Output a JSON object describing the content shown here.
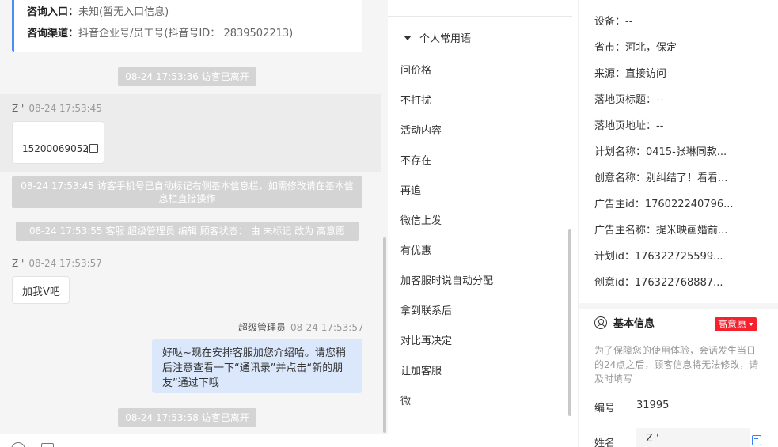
{
  "chat": {
    "info_card": {
      "entry_label": "咨询入口：",
      "entry_value": "未知(暂无入口信息)",
      "channel_label": "咨询渠道：",
      "channel_value": "抖音企业号/员工号(抖音号ID： 2839502213)"
    },
    "sys_left_1": "08-24 17:53:36 访客已离开",
    "visitor_name": "Z '",
    "msg1_time": "08-24 17:53:45",
    "msg1_text": "15200069052",
    "sys_phone_note": "08-24 17:53:45 访客手机号已自动标记右侧基本信息栏，如需修改请在基本信息栏直接操作",
    "sys_status_change": "08-24 17:53:55 客服 超级管理员 编辑 顾客状态： 由 未标记 改为 高意愿",
    "msg2_time": "08-24 17:53:57",
    "msg2_text": "加我V吧",
    "agent_name": "超级管理员",
    "msg3_time": "08-24 17:53:57",
    "msg3_text": "好哒~现在安排客服加您介绍哈。请您稍后注意查看一下“通讯录”并点击“新的朋友”通过下哦",
    "sys_left_2": "08-24 17:53:58 访客已离开"
  },
  "phrases": {
    "header": "个人常用语",
    "items": [
      "问价格",
      "不打扰",
      "活动内容",
      "不存在",
      "再追",
      "微信上发",
      "有优惠",
      "加客服时说自动分配",
      "拿到联系后",
      "对比再决定",
      "让加客服",
      "微"
    ]
  },
  "right": {
    "kv": [
      "设备：--",
      "省市：河北，保定",
      "来源：直接访问",
      "落地页标题：--",
      "落地页地址：--",
      "计划名称：0415-张琳同款...",
      "创意名称：别纠结了！看看...",
      "广告主id：176022240796...",
      "广告主名称：提米映画婚前...",
      "计划id：176322725599...",
      "创意id：176322768887..."
    ],
    "basic_info_title": "基本信息",
    "intent_badge": "高意愿",
    "notice": "为了保障您的使用体验，会话发生当日的24点之后，顾客信息将无法修改，请及时填写",
    "number_label": "编号",
    "number_value": "31995",
    "name_label": "姓名",
    "name_value": "Z '"
  },
  "colors": {
    "accent_blue": "#4a8ef5",
    "badge_red": "#f5222d",
    "agent_bubble": "#dbe8fb"
  }
}
